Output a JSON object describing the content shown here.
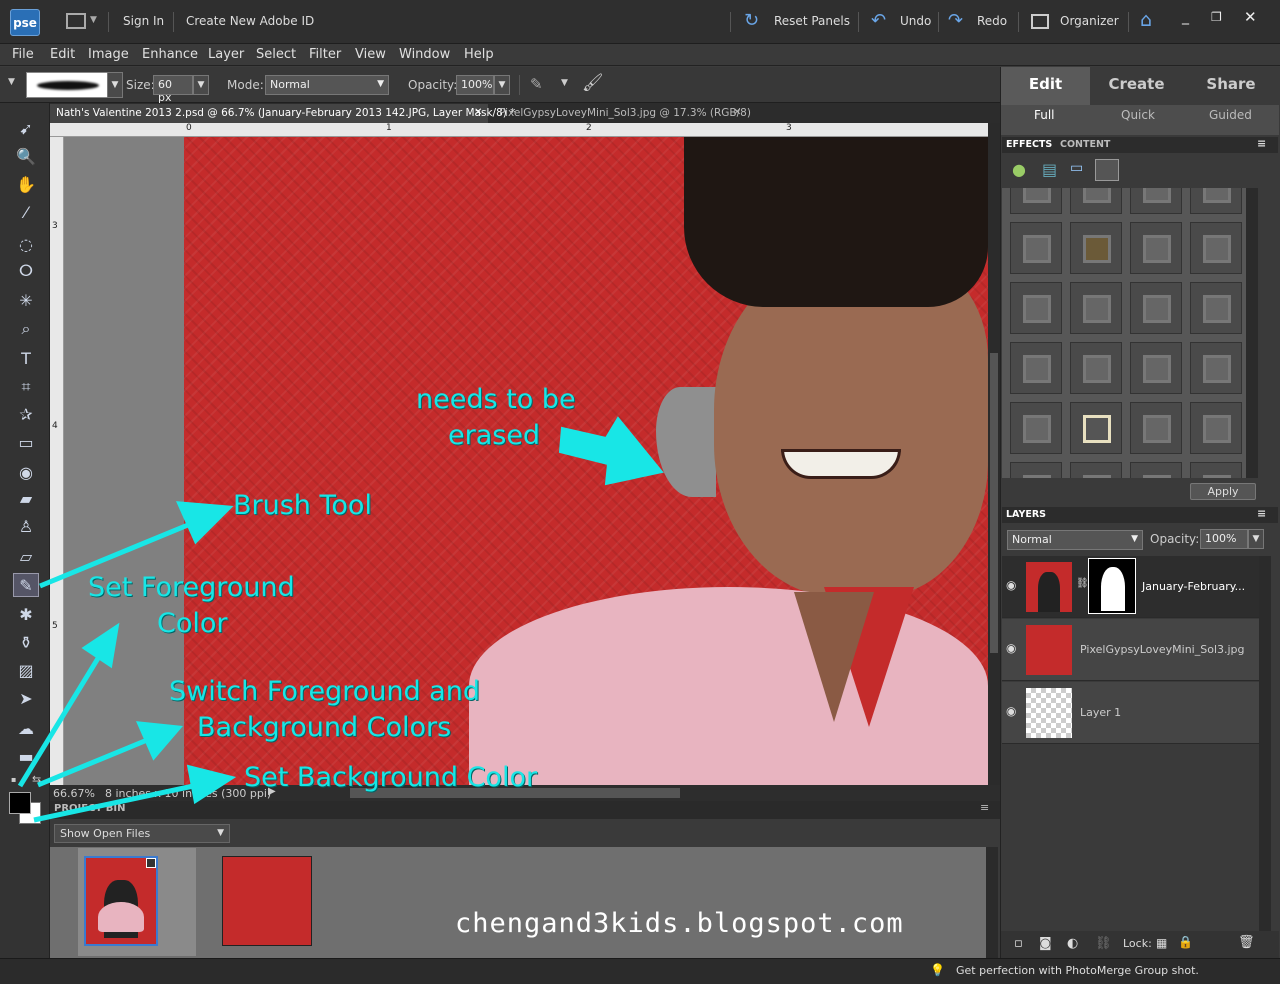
{
  "app": {
    "logo_text": "pse"
  },
  "titlebar": {
    "sign_in": "Sign In",
    "create_id": "Create New Adobe ID",
    "reset_panels": "Reset Panels",
    "undo": "Undo",
    "redo": "Redo",
    "organizer": "Organizer"
  },
  "menu": [
    "File",
    "Edit",
    "Image",
    "Enhance",
    "Layer",
    "Select",
    "Filter",
    "View",
    "Window",
    "Help"
  ],
  "options": {
    "size_label": "Size:",
    "size_value": "60 px",
    "mode_label": "Mode:",
    "mode_value": "Normal",
    "opacity_label": "Opacity:",
    "opacity_value": "100%"
  },
  "doc_tabs": [
    {
      "label": "Nath's Valentine 2013 2.psd @ 66.7% (January-February 2013 142.JPG, Layer Mask/8) *"
    },
    {
      "label": "PixelGypsyLoveyMini_Sol3.jpg @ 17.3% (RGB/8)"
    }
  ],
  "ruler": {
    "h": [
      "0",
      "1",
      "2",
      "3"
    ],
    "v": [
      "3",
      "4",
      "5"
    ]
  },
  "status": {
    "zoom": "66.67%",
    "doc_size": "8 inches x 10 inches (300 ppi)"
  },
  "project_bin": {
    "title": "PROJECT BIN",
    "show": "Show Open Files"
  },
  "panel": {
    "tabs": [
      "Edit",
      "Create",
      "Share"
    ],
    "subtabs": [
      "Full",
      "Quick",
      "Guided"
    ],
    "effects_tab": "EFFECTS",
    "content_tab": "CONTENT",
    "apply": "Apply",
    "layers_title": "LAYERS",
    "blend_mode": "Normal",
    "opacity_label": "Opacity:",
    "opacity_value": "100%",
    "lock_label": "Lock:"
  },
  "layers": [
    {
      "name": "January-February..."
    },
    {
      "name": "PixelGypsyLoveyMini_Sol3.jpg"
    },
    {
      "name": "Layer 1"
    }
  ],
  "annotations": {
    "erase": "needs to be",
    "erase2": "erased",
    "brush": "Brush Tool",
    "fg": "Set Foreground",
    "fg2": "Color",
    "switch": "Switch Foreground and",
    "switch2": "Background Colors",
    "bg": "Set Background Color"
  },
  "watermark": "chengand3kids.blogspot.com",
  "tip": "Get perfection with PhotoMerge Group shot.",
  "colors": {
    "annotation": "#18e6e6",
    "paper": "#c42b2b",
    "accent": "#2a6fb6"
  }
}
